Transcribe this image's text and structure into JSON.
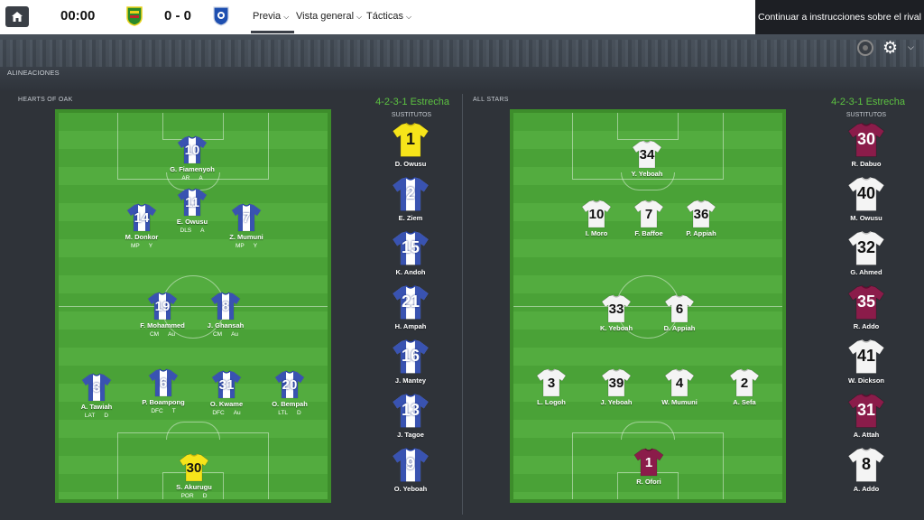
{
  "topbar": {
    "clock": "00:00",
    "score": "0 - 0",
    "nav": [
      "Previa",
      "Vista general",
      "Tácticas"
    ],
    "cta": "Continuar a instrucciones sobre el rival"
  },
  "section_label": "ALINEACIONES",
  "colors": {
    "accent_green": "#5cc241",
    "home_shirt": "#2340a8",
    "away_shirt": "#ffffff",
    "gk_home": "#f6e41a",
    "gk_away": "#8b1c4a"
  },
  "home": {
    "name": "HEARTS OF OAK",
    "formation": "4-2-3-1 Estrecha",
    "subs_label": "SUSTITUTOS",
    "players": [
      {
        "num": "10",
        "name": "G. Fiamenyoh",
        "role": [
          "AR",
          "A"
        ]
      },
      {
        "num": "11",
        "name": "E. Owusu",
        "role": [
          "DLS",
          "A"
        ]
      },
      {
        "num": "14",
        "name": "M. Donkor",
        "role": [
          "MP",
          "Y"
        ]
      },
      {
        "num": "7",
        "name": "Z. Mumuni",
        "role": [
          "MP",
          "Y"
        ]
      },
      {
        "num": "19",
        "name": "F. Mohammed",
        "role": [
          "CM",
          "Au"
        ]
      },
      {
        "num": "8",
        "name": "J. Ghansah",
        "role": [
          "CM",
          "Au"
        ]
      },
      {
        "num": "3",
        "name": "A. Tawiah",
        "role": [
          "LAT",
          "D"
        ]
      },
      {
        "num": "6",
        "name": "P. Boampong",
        "role": [
          "DFC",
          "T"
        ]
      },
      {
        "num": "31",
        "name": "O. Kwame",
        "role": [
          "DFC",
          "Au"
        ]
      },
      {
        "num": "20",
        "name": "O. Bempah",
        "role": [
          "LTL",
          "D"
        ]
      },
      {
        "num": "30",
        "name": "S. Akurugu",
        "role": [
          "POR",
          "D"
        ]
      }
    ],
    "subs": [
      {
        "num": "1",
        "name": "D. Owusu"
      },
      {
        "num": "2",
        "name": "E. Ziem"
      },
      {
        "num": "15",
        "name": "K. Andoh"
      },
      {
        "num": "21",
        "name": "H. Ampah"
      },
      {
        "num": "16",
        "name": "J. Mantey"
      },
      {
        "num": "13",
        "name": "J. Tagoe"
      },
      {
        "num": "9",
        "name": "O. Yeboah"
      }
    ]
  },
  "away": {
    "name": "ALL STARS",
    "formation": "4-2-3-1 Estrecha",
    "subs_label": "SUSTITUTOS",
    "players": [
      {
        "num": "34",
        "name": "Y. Yeboah"
      },
      {
        "num": "10",
        "name": "I. Moro"
      },
      {
        "num": "7",
        "name": "F. Baffoe"
      },
      {
        "num": "36",
        "name": "P. Appiah"
      },
      {
        "num": "33",
        "name": "K. Yeboah"
      },
      {
        "num": "6",
        "name": "D. Appiah"
      },
      {
        "num": "3",
        "name": "L. Logoh"
      },
      {
        "num": "39",
        "name": "J. Yeboah"
      },
      {
        "num": "4",
        "name": "W. Mumuni"
      },
      {
        "num": "2",
        "name": "A. Sefa"
      },
      {
        "num": "1",
        "name": "R. Ofori"
      }
    ],
    "subs": [
      {
        "num": "30",
        "name": "R. Dabuo"
      },
      {
        "num": "40",
        "name": "M. Owusu"
      },
      {
        "num": "32",
        "name": "G. Ahmed"
      },
      {
        "num": "35",
        "name": "R. Addo"
      },
      {
        "num": "41",
        "name": "W. Dickson"
      },
      {
        "num": "31",
        "name": "A. Attah"
      },
      {
        "num": "8",
        "name": "A. Addo"
      }
    ]
  }
}
